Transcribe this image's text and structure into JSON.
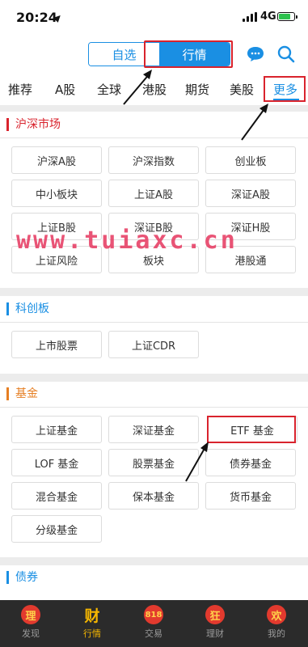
{
  "status": {
    "time": "20:24",
    "network": "4G"
  },
  "header": {
    "segments": [
      {
        "label": "自选"
      },
      {
        "label": "行情"
      }
    ]
  },
  "tabs": [
    {
      "label": "推荐"
    },
    {
      "label": "A股"
    },
    {
      "label": "全球"
    },
    {
      "label": "港股"
    },
    {
      "label": "期货"
    },
    {
      "label": "美股"
    },
    {
      "label": "更多"
    }
  ],
  "sections": {
    "hushen": {
      "title": "沪深市场",
      "items": [
        "沪深A股",
        "沪深指数",
        "创业板",
        "中小板块",
        "上证A股",
        "深证A股",
        "上证B股",
        "深证B股",
        "深证H股",
        "上证风险",
        "板块",
        "港股通"
      ]
    },
    "kechuang": {
      "title": "科创板",
      "items": [
        "上市股票",
        "上证CDR"
      ]
    },
    "fund": {
      "title": "基金",
      "items": [
        "上证基金",
        "深证基金",
        "ETF 基金",
        "LOF 基金",
        "股票基金",
        "债券基金",
        "混合基金",
        "保本基金",
        "货币基金",
        "分级基金"
      ]
    },
    "bond": {
      "title": "债券"
    }
  },
  "watermark": "www.tuiaxc.cn",
  "bottom_nav": [
    {
      "icon": "理",
      "label": "发现"
    },
    {
      "icon": "财",
      "label": "行情"
    },
    {
      "icon": "818",
      "label": "交易"
    },
    {
      "icon": "狂",
      "label": "理财"
    },
    {
      "icon": "欢",
      "label": "我的"
    }
  ],
  "colors": {
    "accent": "#1a8fe3",
    "highlight": "#d9232d",
    "section_fund": "#e67e22",
    "nav_active": "#f6b700"
  }
}
